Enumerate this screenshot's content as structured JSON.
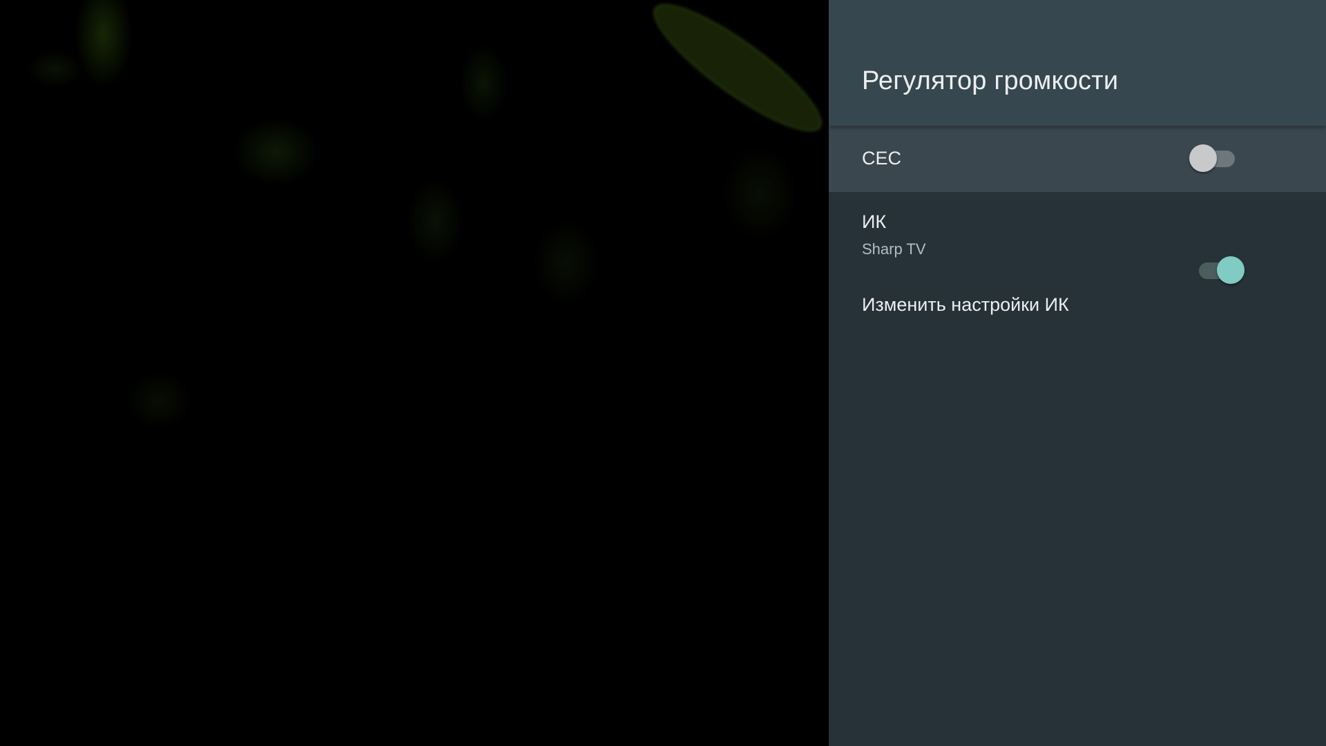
{
  "panel": {
    "title": "Регулятор громкости",
    "items": [
      {
        "title": "CEC",
        "toggle": false
      },
      {
        "title": "ИК",
        "summary": "Sharp TV",
        "toggle": true
      },
      {
        "title": "Изменить настройки ИК"
      }
    ]
  },
  "colors": {
    "panel_bg": "#263238",
    "header_bg": "#37474f",
    "focused_row_bg": "#3b474e",
    "switch_on_accent": "#80cbc4"
  }
}
